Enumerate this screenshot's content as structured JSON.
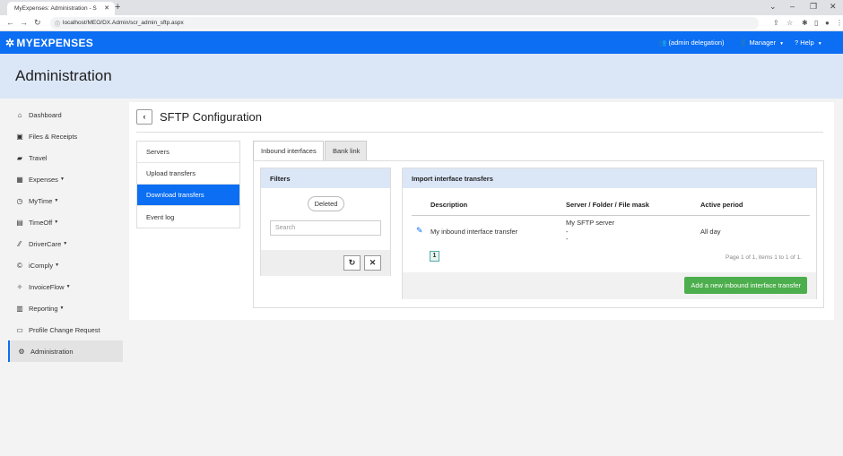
{
  "browser": {
    "tab_title": "MyExpenses: Administration - S",
    "url": "localhost/MEO/DX.Admin/scr_admin_sftp.aspx"
  },
  "app": {
    "logo": "MYEXPENSES",
    "nav": {
      "delegation": "(admin delegation)",
      "manager": "Manager",
      "help": "Help"
    }
  },
  "page": {
    "title": "Administration"
  },
  "sidebar": {
    "items": [
      {
        "label": "Dashboard",
        "icon": "home-icon"
      },
      {
        "label": "Files & Receipts",
        "icon": "image-icon"
      },
      {
        "label": "Travel",
        "icon": "suitcase-icon"
      },
      {
        "label": "Expenses",
        "icon": "calculator-icon"
      },
      {
        "label": "MyTime",
        "icon": "stopwatch-icon"
      },
      {
        "label": "TimeOff",
        "icon": "calendar-icon"
      },
      {
        "label": "DriverCare",
        "icon": "road-icon"
      },
      {
        "label": "iComply",
        "icon": "copyright-icon"
      },
      {
        "label": "InvoiceFlow",
        "icon": "invoice-icon"
      },
      {
        "label": "Reporting",
        "icon": "chart-icon"
      },
      {
        "label": "Profile Change Request",
        "icon": "inbox-icon"
      },
      {
        "label": "Administration",
        "icon": "gears-icon"
      }
    ]
  },
  "sftp": {
    "title": "SFTP Configuration",
    "subnav": [
      "Servers",
      "Upload transfers",
      "Download transfers",
      "Event log"
    ],
    "tabs": [
      "Inbound interfaces",
      "Bank link"
    ],
    "filters": {
      "heading": "Filters",
      "deleted_label": "Deleted",
      "search_placeholder": "Search"
    },
    "imports": {
      "heading": "Import interface transfers",
      "columns": [
        "Description",
        "Server / Folder / File mask",
        "Active period"
      ],
      "rows": [
        {
          "description": "My inbound interface transfer",
          "server": "My SFTP server",
          "folder": "-",
          "mask": "-",
          "active": "All day"
        }
      ],
      "page": "1",
      "page_info": "Page 1 of 1, items 1 to 1 of 1.",
      "add_button": "Add a new inbound interface transfer"
    }
  },
  "colors": {
    "brand": "#0b6ef3",
    "banner": "#dbe6f7",
    "add_button": "#4cae4c"
  }
}
